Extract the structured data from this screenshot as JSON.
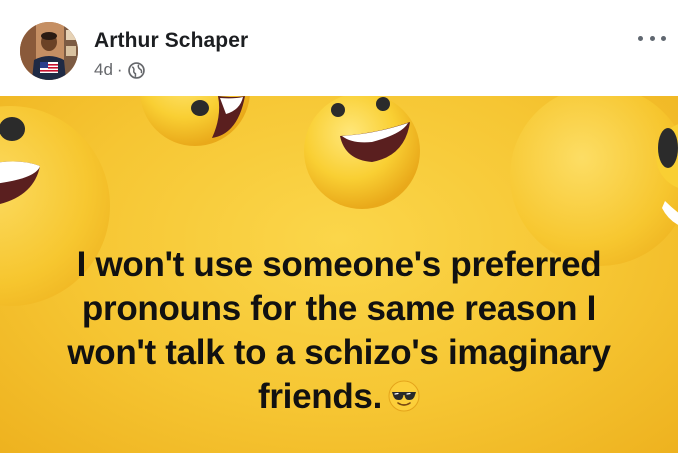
{
  "post": {
    "author_name": "Arthur Schaper",
    "time_ago": "4d",
    "separator": "·",
    "audience_icon": "globe-icon",
    "more_icon": "more-options-icon"
  },
  "image": {
    "background_color": "#f6c633",
    "caption_lines": [
      "I won't use someone's preferred",
      "pronouns for the same reason I",
      "won't talk to a schizo's imaginary",
      "friends."
    ],
    "caption_emoji": "sunglasses-emoji-icon",
    "decorations": "laughing-emoji-icon"
  }
}
